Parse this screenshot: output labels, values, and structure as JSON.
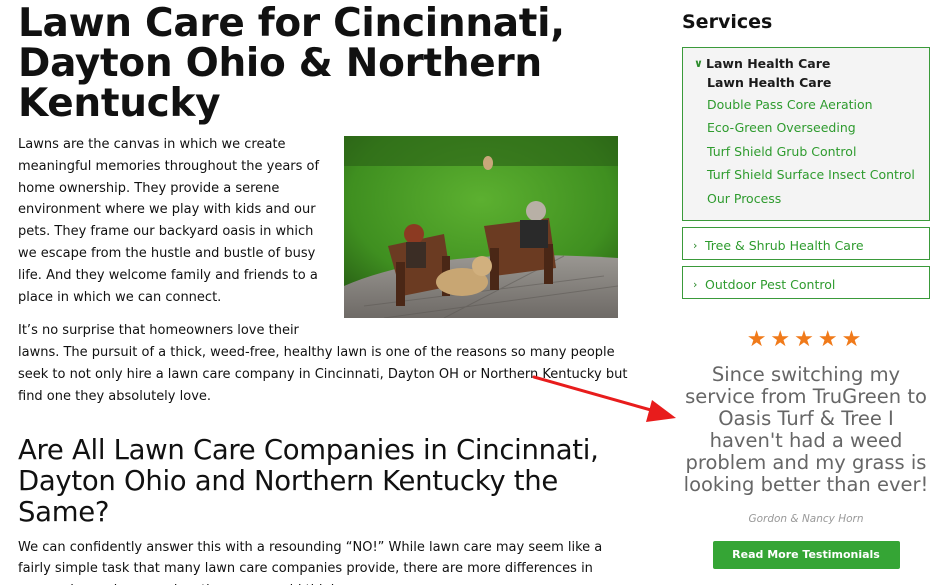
{
  "main": {
    "title": "Lawn Care for Cincinnati, Dayton Ohio & Northern Kentucky",
    "para1": "Lawns are the canvas in which we create meaningful memories throughout the years of home ownership. They provide a serene environment where we play with kids and our pets. They frame our backyard oasis in which we escape from the hustle and bustle of busy life. And they welcome family and friends to a place in which we can connect.",
    "para2": "It’s no surprise that homeowners love their lawns. The pursuit of a thick, weed-free, healthy lawn is one of the reasons so many people seek to not only hire a lawn care company in Cincinnati, Dayton OH or Northern Kentucky but find one they absolutely love.",
    "section_heading": "Are All Lawn Care Companies in Cincinnati, Dayton Ohio and Northern Kentucky the Same?",
    "section_para": "We can confidently answer this with a resounding “NO!” While lawn care may seem like a fairly simple task that many lawn care companies provide, there are more differences in companies and approaches than you would think."
  },
  "sidebar": {
    "title": "Services",
    "open_group": {
      "label": "Lawn Health Care",
      "items": [
        "Lawn Health Care",
        "Double Pass Core Aeration",
        "Eco-Green Overseeding",
        "Turf Shield Grub Control",
        "Turf Shield Surface Insect Control",
        "Our Process"
      ]
    },
    "group2": "Tree & Shrub Health Care",
    "group3": "Outdoor Pest Control",
    "testimonial": {
      "stars": "★★★★★",
      "rating": 5,
      "quote": "Since switching my service from TruGreen to Oasis Turf & Tree I haven't had a weed problem and my grass is looking better than ever!",
      "author": "Gordon & Nancy Horn",
      "button": "Read More Testimonials"
    }
  },
  "colors": {
    "brand_green": "#35a535",
    "link_green": "#2e9b2e",
    "star_orange": "#f07a1a",
    "arrow_red": "#e81c1c"
  }
}
